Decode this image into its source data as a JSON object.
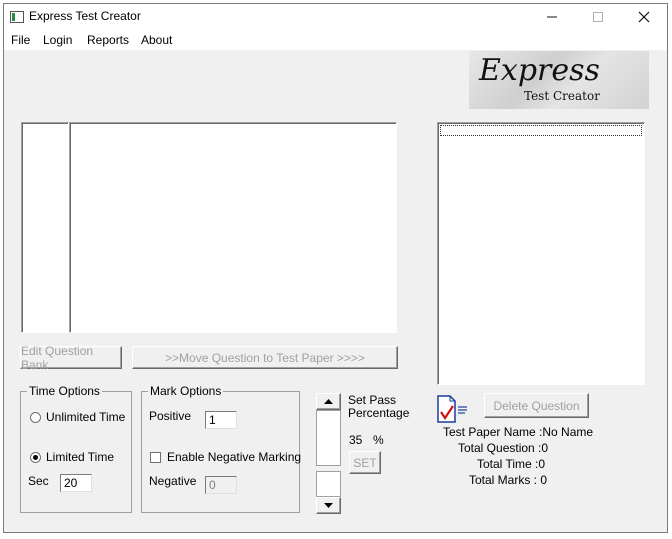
{
  "window": {
    "title": "Express Test Creator"
  },
  "menu": {
    "items": [
      "File",
      "Login",
      "Reports",
      "About"
    ]
  },
  "logo": {
    "title": "Express",
    "subtitle": "Test Creator"
  },
  "buttons": {
    "edit_question_bank": "Edit Question Bank",
    "move_question": ">>Move Question to Test Paper >>>>",
    "delete_question": "Delete Question",
    "set": "SET"
  },
  "time_options": {
    "legend": "Time Options",
    "unlimited_label": "Unlimited Time",
    "limited_label": "Limited Time",
    "sec_label": "Sec",
    "sec_value": "20",
    "selected": "limited"
  },
  "mark_options": {
    "legend": "Mark Options",
    "positive_label": "Positive",
    "positive_value": "1",
    "negative_checkbox_label": "Enable Negative Marking",
    "negative_checked": false,
    "negative_label": "Negative",
    "negative_value": "0"
  },
  "pass": {
    "label_line1": "Set Pass",
    "label_line2": "Percentage",
    "value": "35",
    "unit": "%"
  },
  "summary": {
    "test_paper_name": "Test Paper Name :No Name",
    "total_question": "Total Question :0",
    "total_time": "Total Time :0",
    "total_marks": "Total Marks : 0"
  }
}
